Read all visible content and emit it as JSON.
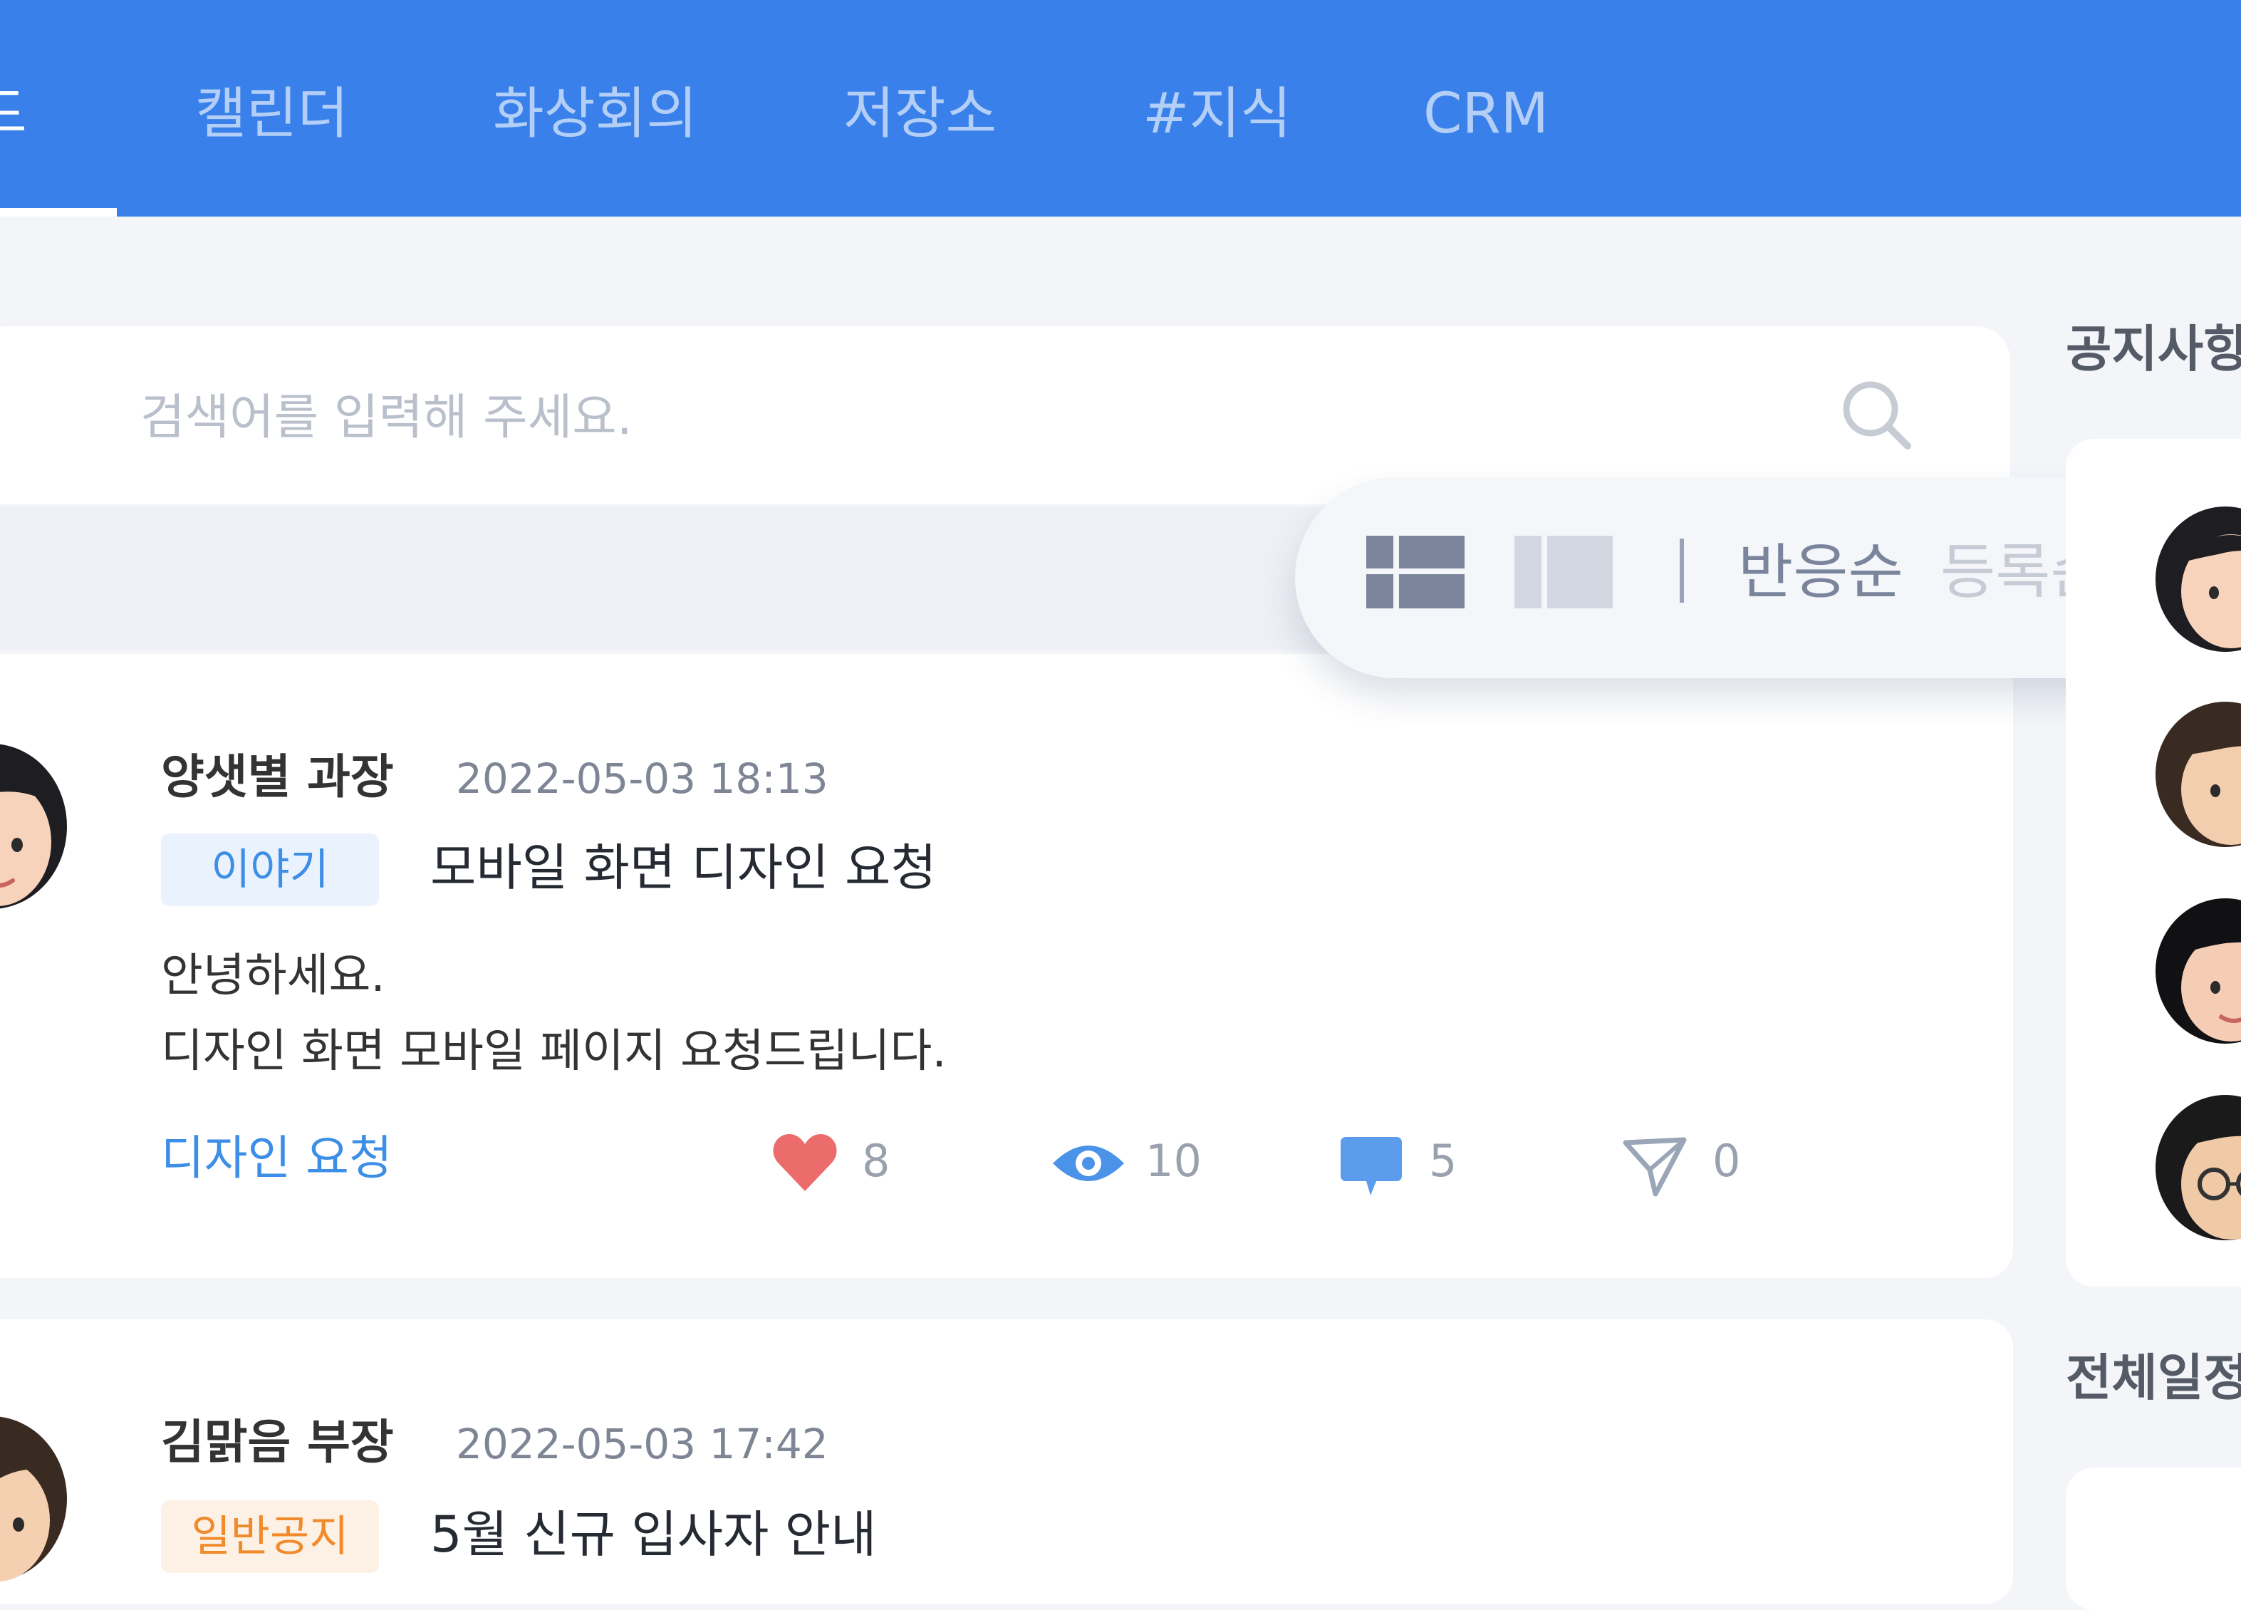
{
  "nav": {
    "active_tab": "드",
    "tabs": [
      "캘린더",
      "화상회의",
      "저장소",
      "#지식",
      "CRM"
    ]
  },
  "search": {
    "placeholder": "검색어를 입력해 주세요."
  },
  "sort": {
    "options": [
      "반응순",
      "등록순"
    ],
    "selected": "반응순"
  },
  "posts": [
    {
      "author": "양샛별 과장",
      "date": "2022-05-03 18:13",
      "category": "이야기",
      "title": "모바일 화면 디자인 요청",
      "body": [
        "안녕하세요.",
        "디자인 화면 모바일 페이지 요청드립니다."
      ],
      "tag": "디자인 요청",
      "likes": "8",
      "views": "10",
      "comments": "5",
      "shares": "0"
    },
    {
      "author": "김맑음 부장",
      "date": "2022-05-03 17:42",
      "category": "일반공지",
      "title": "5월 신규 입사자 안내"
    }
  ],
  "sidebar": {
    "notice_title": "공지사항",
    "schedule_title": "전체일정"
  },
  "colors": {
    "header": "#3980EA",
    "accent_blue": "#3D8EE6",
    "like_red": "#EC6B6B",
    "badge_story_bg": "#EAF2FD",
    "badge_notice_bg": "#FDF0E4",
    "badge_notice_text": "#F08A2A"
  }
}
